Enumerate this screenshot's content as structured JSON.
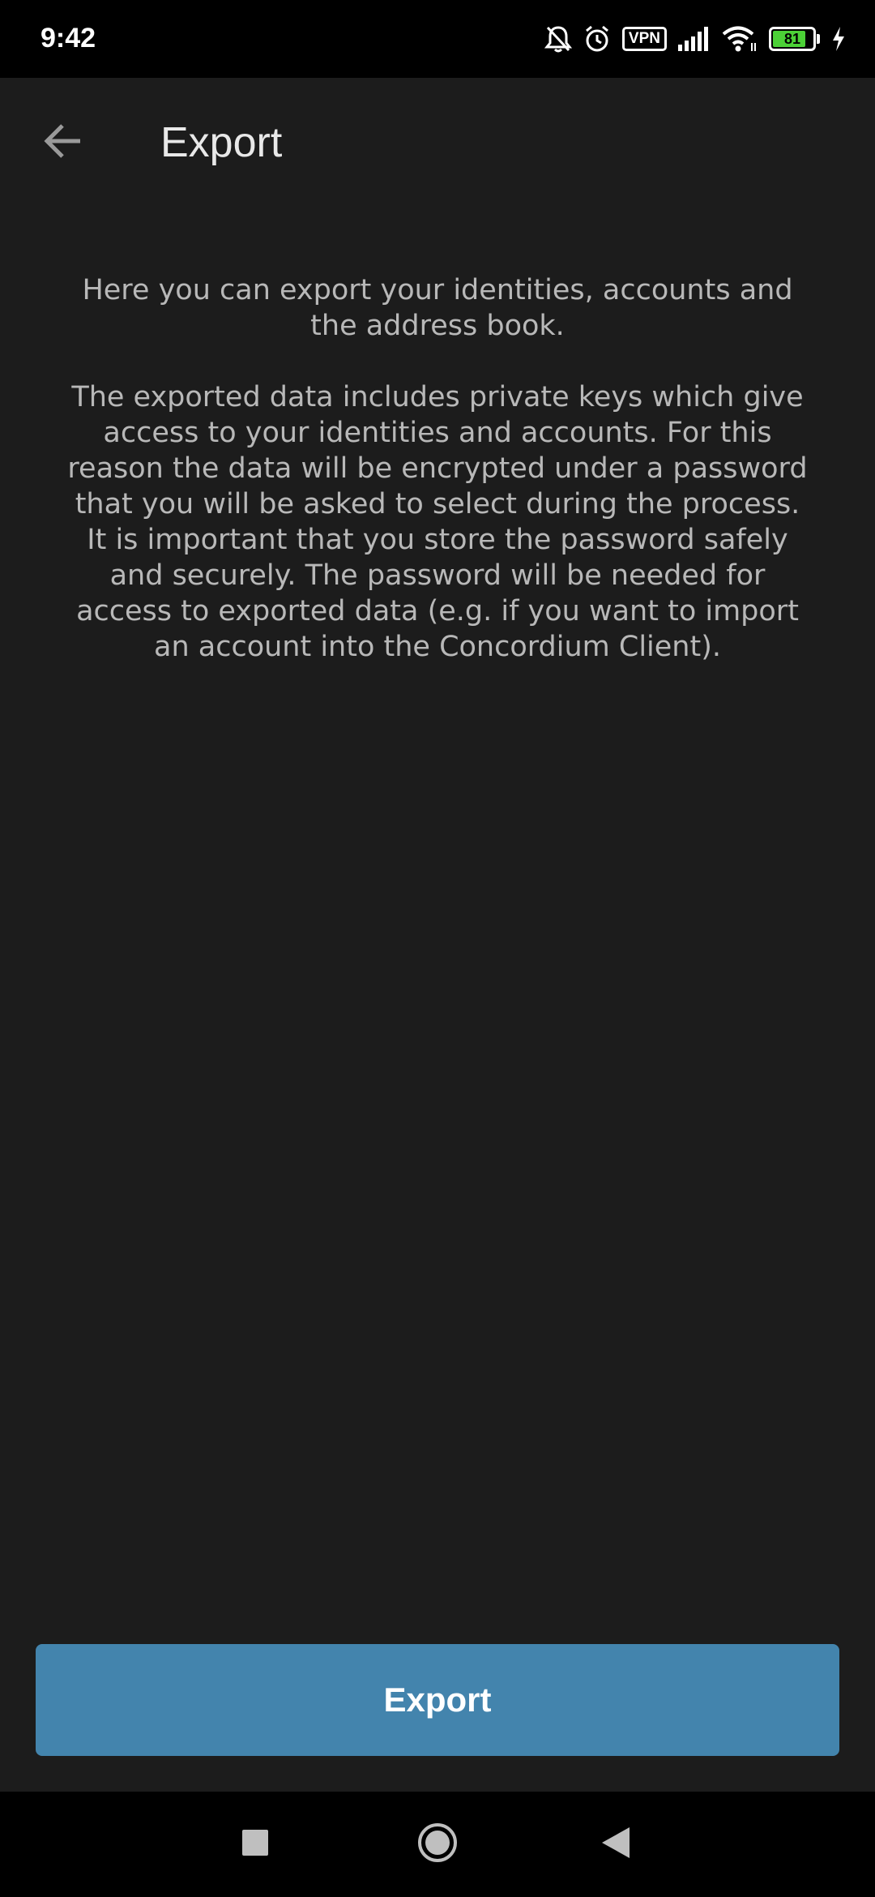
{
  "status_bar": {
    "time": "9:42",
    "vpn_label": "VPN",
    "battery_level": "81",
    "icons": [
      "bell-off-icon",
      "alarm-icon",
      "vpn-icon",
      "signal-icon",
      "wifi-icon",
      "battery-icon",
      "charging-icon"
    ]
  },
  "toolbar": {
    "back_icon": "arrow-left-icon",
    "title": "Export"
  },
  "content": {
    "intro": "Here you can export your identities, accounts and the address book.",
    "details": "The exported data includes private keys which give access to your identities and accounts. For this reason the data will be encrypted under a password that you will be asked to select during the process. It is important that you store the password safely and securely. The password will be needed for access to exported data (e.g. if you want to import an account into the Concordium Client)."
  },
  "actions": {
    "export_label": "Export"
  },
  "nav_bar": {
    "icons": [
      "recents-square-icon",
      "home-circle-icon",
      "back-triangle-icon"
    ]
  },
  "colors": {
    "background": "#1c1c1c",
    "button": "#4384ad",
    "text": "#b8b8b8",
    "title": "#e8e8e8"
  }
}
